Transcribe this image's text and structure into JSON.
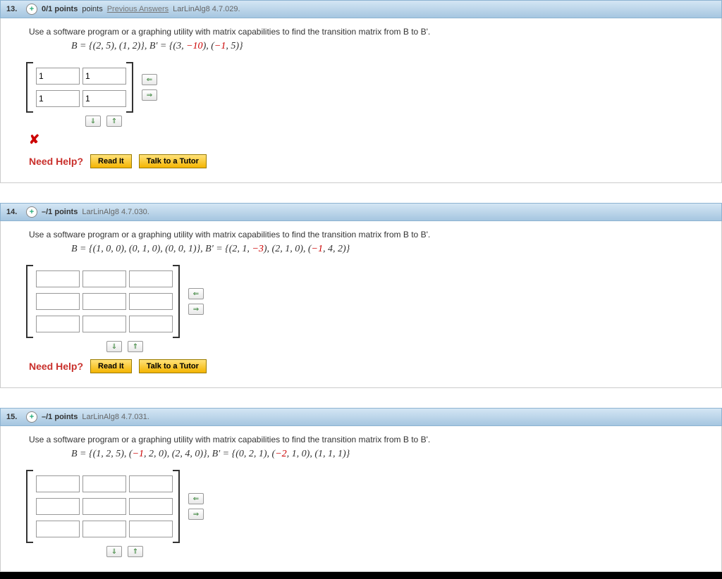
{
  "labels": {
    "prev_answers": "Previous Answers",
    "need_help": "Need Help?",
    "read_it": "Read It",
    "talk_tutor": "Talk to a Tutor",
    "points_sep": " points",
    "neg_points": "–/1 points"
  },
  "q13": {
    "num": "13.",
    "points": "0/1 points",
    "ref": "LarLinAlg8 4.7.029.",
    "prompt": "Use a software program or a graphing utility with matrix capabilities to find the transition matrix from B to B'.",
    "basis_html": "B = {(2, 5), (1, 2)}, B' = {(3, <span class='neg'>−10</span>), (<span class='neg'>−1</span>, 5)}",
    "matrix_vals": [
      "1",
      "1",
      "1",
      "1"
    ]
  },
  "q14": {
    "num": "14.",
    "ref": "LarLinAlg8 4.7.030.",
    "prompt": "Use a software program or a graphing utility with matrix capabilities to find the transition matrix from B to B'.",
    "basis_html": "B = {(1, 0, 0), (0, 1, 0), (0, 0, 1)}, B' = {(2, 1, <span class='neg'>−3</span>), (2, 1, 0), (<span class='neg'>−1</span>, 4, 2)}"
  },
  "q15": {
    "num": "15.",
    "ref": "LarLinAlg8 4.7.031.",
    "prompt": "Use a software program or a graphing utility with matrix capabilities to find the transition matrix from B to B'.",
    "basis_html": "B = {(1, 2, 5), (<span class='neg'>−1</span>, 2, 0), (2, 4, 0)}, B' = {(0, 2, 1), (<span class='neg'>−2</span>, 1, 0), (1, 1, 1)}"
  }
}
